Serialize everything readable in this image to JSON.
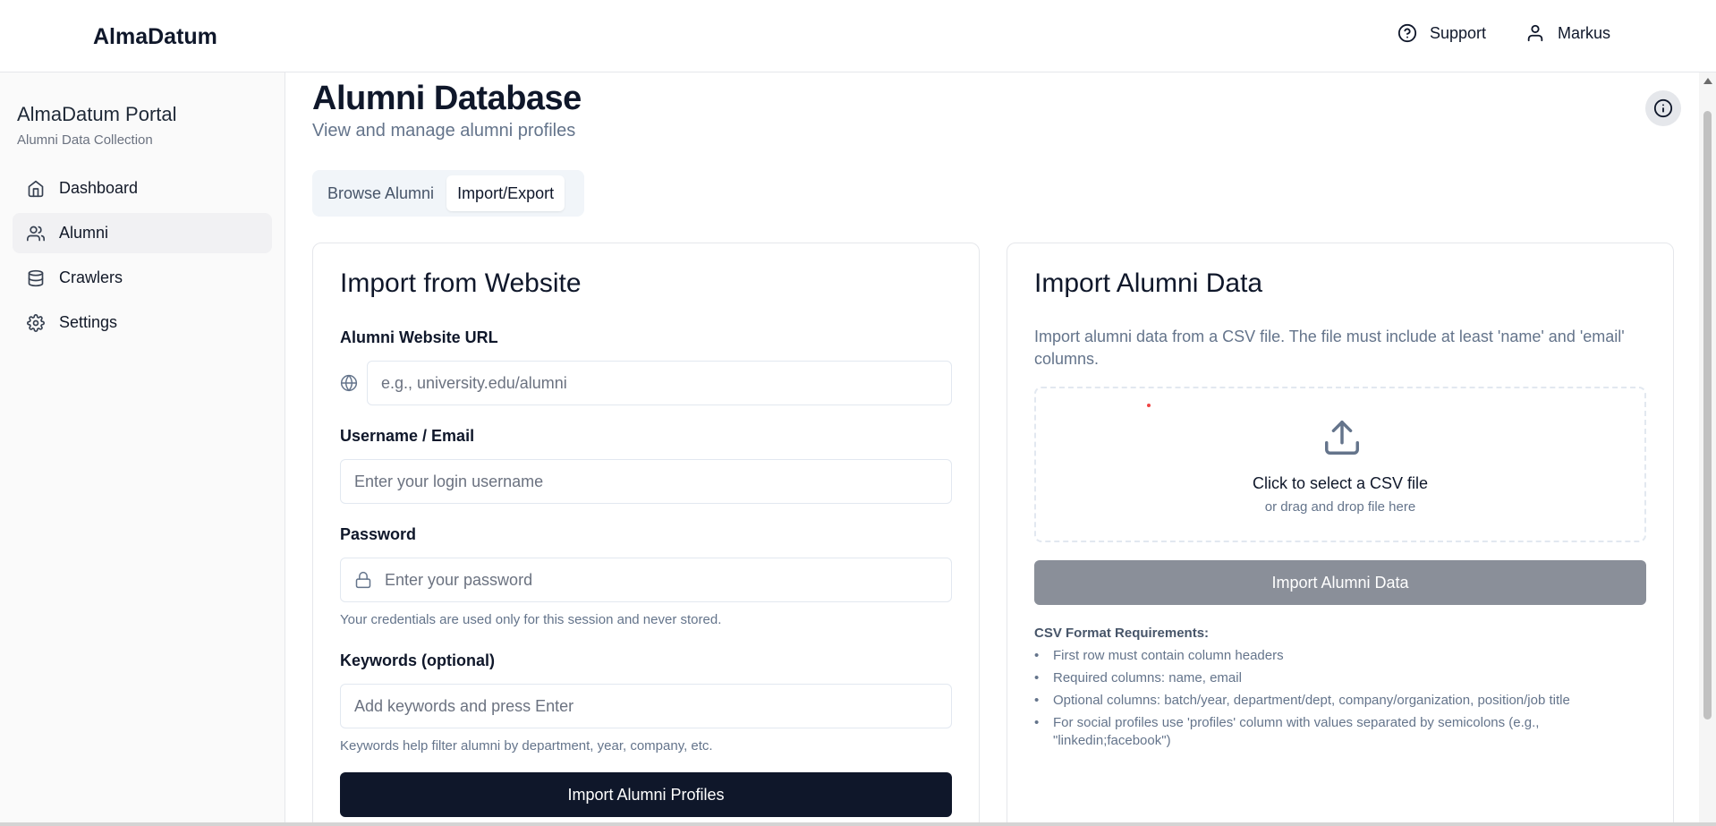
{
  "header": {
    "brand": "AlmaDatum",
    "support_label": "Support",
    "user_name": "Markus",
    "support_icon": "help-circle-icon",
    "user_icon": "user-icon"
  },
  "sidebar": {
    "title": "AlmaDatum Portal",
    "subtitle": "Alumni Data Collection",
    "items": [
      {
        "label": "Dashboard",
        "icon": "home-icon",
        "active": false
      },
      {
        "label": "Alumni",
        "icon": "users-icon",
        "active": true
      },
      {
        "label": "Crawlers",
        "icon": "database-icon",
        "active": false
      },
      {
        "label": "Settings",
        "icon": "gear-icon",
        "active": false
      }
    ]
  },
  "main": {
    "title": "Alumni Database",
    "subtitle": "View and manage alumni profiles",
    "tabs": [
      {
        "label": "Browse Alumni",
        "active": false
      },
      {
        "label": "Import/Export",
        "active": true
      }
    ]
  },
  "import_website": {
    "title": "Import from Website",
    "url_label": "Alumni Website URL",
    "url_placeholder": "e.g., university.edu/alumni",
    "username_label": "Username / Email",
    "username_placeholder": "Enter your login username",
    "password_label": "Password",
    "password_placeholder": "Enter your password",
    "credentials_hint": "Your credentials are used only for this session and never stored.",
    "keywords_label": "Keywords (optional)",
    "keywords_placeholder": "Add keywords and press Enter",
    "keywords_hint": "Keywords help filter alumni by department, year, company, etc.",
    "submit_label": "Import Alumni Profiles"
  },
  "import_csv": {
    "title": "Import Alumni Data",
    "description": "Import alumni data from a CSV file. The file must include at least 'name' and 'email' columns.",
    "dropzone_title": "Click to select a CSV file",
    "dropzone_sub": "or drag and drop file here",
    "submit_label": "Import Alumni Data",
    "requirements_title": "CSV Format Requirements:",
    "requirements": [
      "First row must contain column headers",
      "Required columns: name, email",
      "Optional columns: batch/year, department/dept, company/organization, position/job title",
      "For social profiles use 'profiles' column with values separated by semicolons (e.g., \"linkedin;facebook\")"
    ]
  },
  "colors": {
    "primary": "#0f172a",
    "disabled": "#8a8f99",
    "muted_text": "#64748b",
    "active_nav": "#f1f1f3"
  }
}
